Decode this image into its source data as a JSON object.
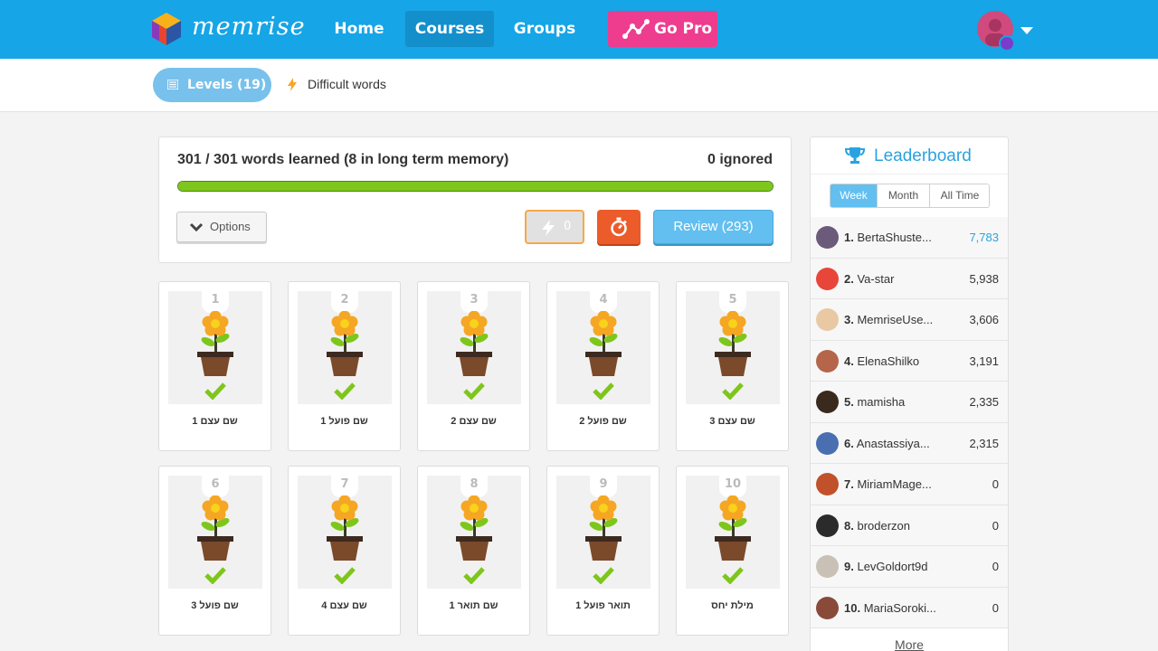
{
  "nav": {
    "logo_text": "memrise",
    "home": "Home",
    "courses": "Courses",
    "groups": "Groups",
    "gopro": "Go Pro"
  },
  "subnav": {
    "levels": "Levels (19)",
    "difficult": "Difficult words"
  },
  "progress": {
    "learned_text": "301 / 301 words learned (8 in long term memory)",
    "ignored_text": "0 ignored",
    "percent": 100,
    "options_label": "Options",
    "speed_count": "0",
    "review_label": "Review (293)"
  },
  "levels": [
    {
      "num": "1",
      "title": "שם עצם 1"
    },
    {
      "num": "2",
      "title": "שם פועל 1"
    },
    {
      "num": "3",
      "title": "שם עצם 2"
    },
    {
      "num": "4",
      "title": "שם פועל 2"
    },
    {
      "num": "5",
      "title": "שם עצם 3"
    },
    {
      "num": "6",
      "title": "שם פועל 3"
    },
    {
      "num": "7",
      "title": "שם עצם 4"
    },
    {
      "num": "8",
      "title": "שם תואר 1"
    },
    {
      "num": "9",
      "title": "תואר פועל 1"
    },
    {
      "num": "10",
      "title": "מילת יחס"
    }
  ],
  "leaderboard": {
    "title": "Leaderboard",
    "tabs": [
      "Week",
      "Month",
      "All Time"
    ],
    "active_tab": "Week",
    "more": "More",
    "rows": [
      {
        "rank": "1.",
        "name": "BertaShuste...",
        "points": "7,783",
        "color": "#6b5a7a"
      },
      {
        "rank": "2.",
        "name": "Va-star",
        "points": "5,938",
        "color": "#e8463a"
      },
      {
        "rank": "3.",
        "name": "MemriseUse...",
        "points": "3,606",
        "color": "#e8c9a4"
      },
      {
        "rank": "4.",
        "name": "ElenaShilko",
        "points": "3,191",
        "color": "#b5654a"
      },
      {
        "rank": "5.",
        "name": "mamisha",
        "points": "2,335",
        "color": "#3a2a1e"
      },
      {
        "rank": "6.",
        "name": "Anastassiya...",
        "points": "2,315",
        "color": "#4a6fb0"
      },
      {
        "rank": "7.",
        "name": "MiriamMage...",
        "points": "0",
        "color": "#c0512a"
      },
      {
        "rank": "8.",
        "name": "broderzon",
        "points": "0",
        "color": "#2b2b2b"
      },
      {
        "rank": "9.",
        "name": "LevGoldort9d",
        "points": "0",
        "color": "#c9c0b6"
      },
      {
        "rank": "10.",
        "name": "MariaSoroki...",
        "points": "0",
        "color": "#8a4a3a"
      }
    ]
  }
}
